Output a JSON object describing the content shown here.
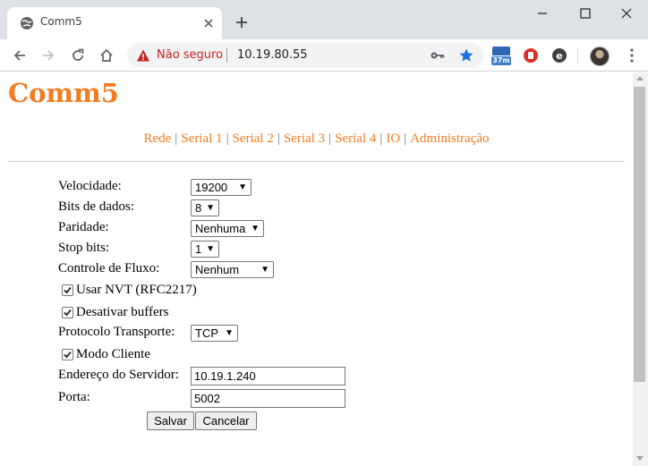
{
  "browser": {
    "tab_title": "Comm5",
    "security_label": "Não seguro",
    "url": "10.19.80.55",
    "extension_badge": "37m"
  },
  "page": {
    "brand": "Comm5",
    "nav": [
      "Rede",
      "Serial 1",
      "Serial 2",
      "Serial 3",
      "Serial 4",
      "IO",
      "Administração"
    ]
  },
  "form": {
    "velocidade": {
      "label": "Velocidade:",
      "value": "19200"
    },
    "bits": {
      "label": "Bits de dados:",
      "value": "8"
    },
    "paridade": {
      "label": "Paridade:",
      "value": "Nenhuma"
    },
    "stopbits": {
      "label": "Stop bits:",
      "value": "1"
    },
    "fluxo": {
      "label": "Controle de Fluxo:",
      "value": "Nenhum"
    },
    "nvt": {
      "label": "Usar NVT (RFC2217)",
      "checked": true
    },
    "buffers": {
      "label": "Desativar buffers",
      "checked": true
    },
    "protocolo": {
      "label": "Protocolo Transporte:",
      "value": "TCP"
    },
    "cliente": {
      "label": "Modo Cliente",
      "checked": true
    },
    "servidor": {
      "label": "Endereço do Servidor:",
      "value": "10.19.1.240"
    },
    "porta": {
      "label": "Porta:",
      "value": "5002"
    },
    "save": "Salvar",
    "cancel": "Cancelar"
  }
}
